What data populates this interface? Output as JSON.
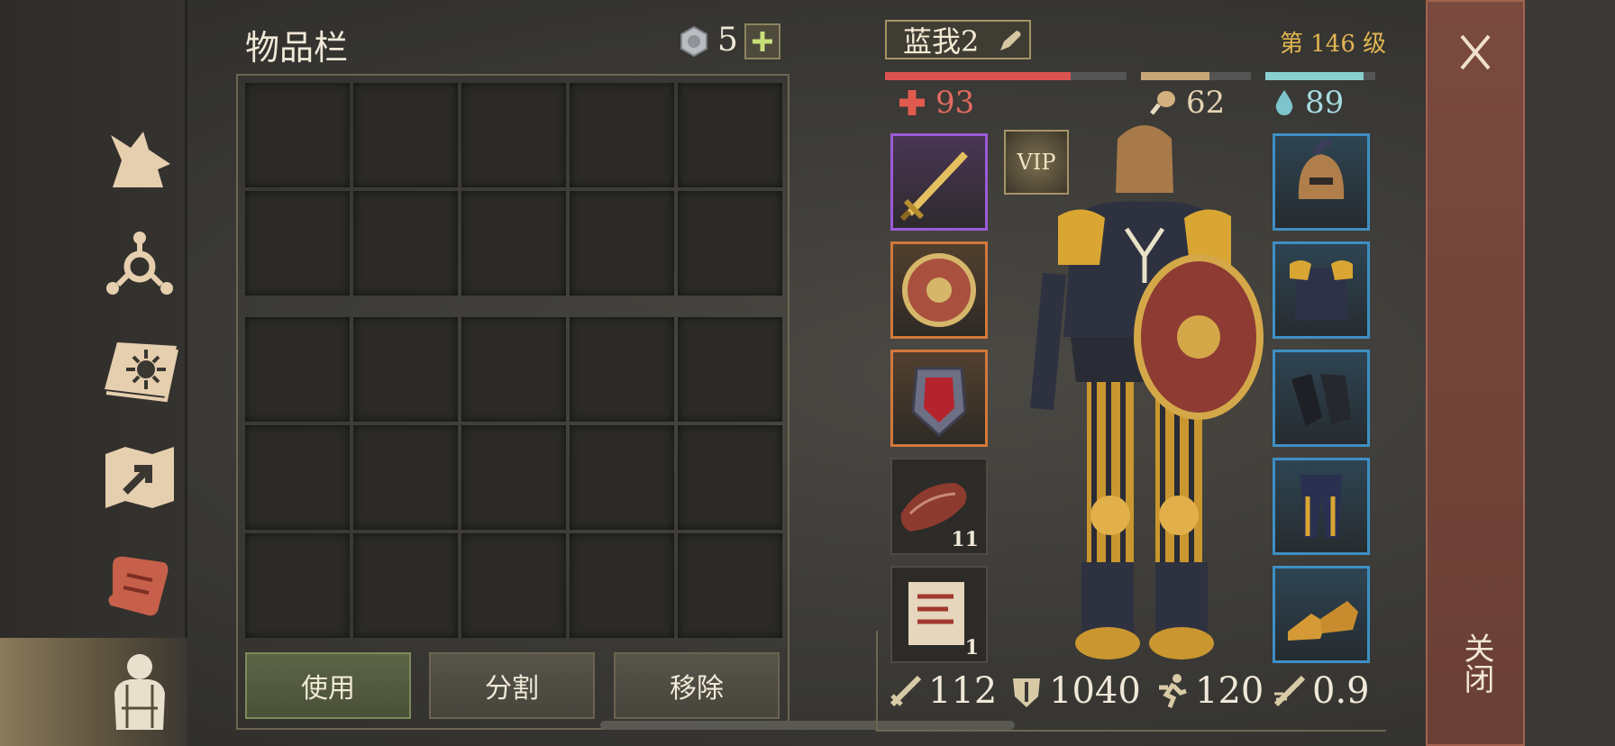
{
  "inventory": {
    "title": "物品栏",
    "coin_count": "5",
    "coin_icon": "silver-coin-icon",
    "actions": {
      "use": "使用",
      "split": "分割",
      "remove": "移除"
    }
  },
  "sidebar": {
    "items": [
      {
        "name": "wolf-icon"
      },
      {
        "name": "crafting-icon"
      },
      {
        "name": "spellbook-icon"
      },
      {
        "name": "map-icon"
      },
      {
        "name": "scroll-icon"
      },
      {
        "name": "character-icon",
        "selected": true
      }
    ]
  },
  "character": {
    "name": "蓝我2",
    "level": "第 146 级",
    "vip_label": "VIP",
    "stats": {
      "health": "93",
      "food": "62",
      "water": "89"
    },
    "bars": {
      "health": 0.77,
      "food": 0.62,
      "water": 0.89
    },
    "colors": {
      "health": "#d9534f",
      "food": "#c8a878",
      "water": "#8ad0d0",
      "level": "#e3b552"
    },
    "left_slots": [
      {
        "name": "gold-sword-icon",
        "rarity": "purple",
        "qty": ""
      },
      {
        "name": "round-shield-icon",
        "rarity": "orange",
        "qty": ""
      },
      {
        "name": "crest-shield-icon",
        "rarity": "orange",
        "qty": ""
      },
      {
        "name": "meat-icon",
        "rarity": "none",
        "qty": "11"
      },
      {
        "name": "recipe-scroll-icon",
        "rarity": "none",
        "qty": "1"
      }
    ],
    "right_slots": [
      {
        "name": "helmet-icon",
        "rarity": "blue"
      },
      {
        "name": "chest-armor-icon",
        "rarity": "blue"
      },
      {
        "name": "gloves-icon",
        "rarity": "blue"
      },
      {
        "name": "leg-armor-icon",
        "rarity": "blue"
      },
      {
        "name": "boots-icon",
        "rarity": "blue"
      }
    ],
    "combat": {
      "attack": "112",
      "armor": "1040",
      "speed": "120",
      "attack_speed": "0.9"
    }
  },
  "close": {
    "label": "关闭"
  }
}
